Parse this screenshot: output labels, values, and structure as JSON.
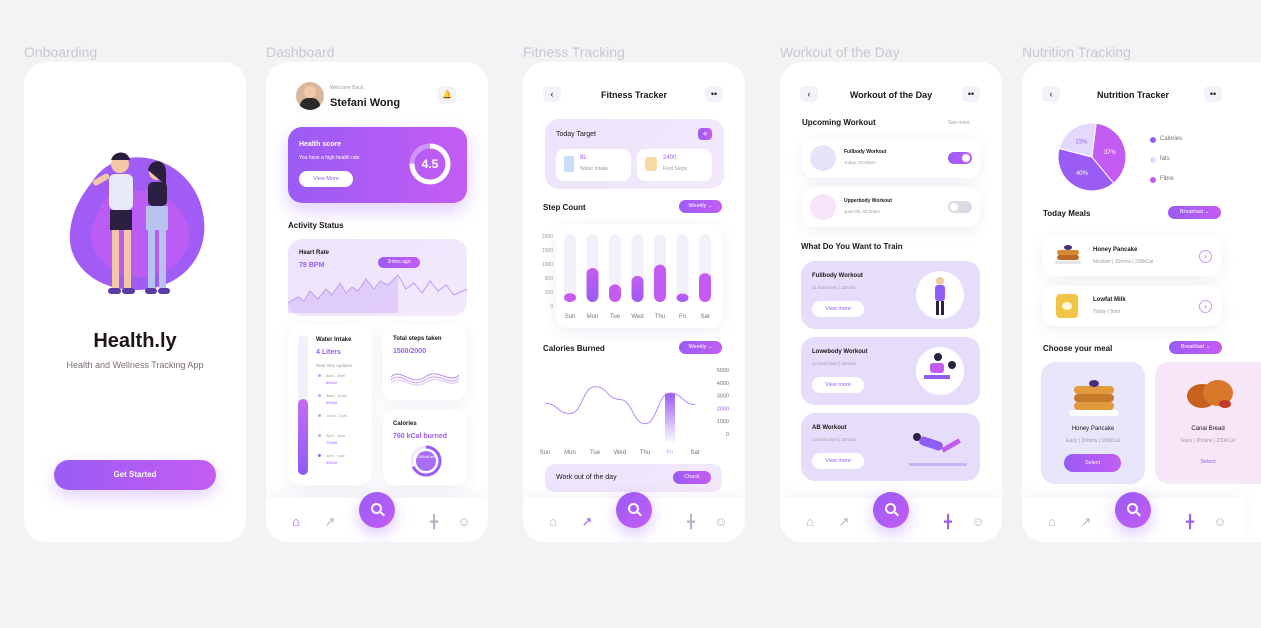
{
  "screen_titles": [
    "Onboarding",
    "Dashboard",
    "Fitness Tracking",
    "Workout of the Day",
    "Nutrition Tracking"
  ],
  "onboarding": {
    "app_name": "Health.ly",
    "tagline": "Health and Wellness  Tracking App",
    "cta": "Get Started"
  },
  "dashboard": {
    "welcome": "Welcome Back,",
    "user_name": "Stefani Wong",
    "health_title": "Health score",
    "health_sub": "You have a high health rate",
    "health_btn": "View More",
    "health_score": "4.5",
    "activity_title": "Activity Status",
    "heart_title": "Heart Rate",
    "heart_value": "78 BPM",
    "heart_badge": "3mins ago",
    "water_title": "Water Intake",
    "water_value": "4 Liters",
    "water_sub": "Real time updates",
    "water_log": [
      {
        "time": "6am - 8am",
        "amount": "600ml"
      },
      {
        "time": "9am - 11am",
        "amount": "500ml"
      },
      {
        "time": "11am - 2pm",
        "amount": ""
      },
      {
        "time": "2pm - 4pm",
        "amount": "700ml"
      },
      {
        "time": "4pm - now",
        "amount": "900ml"
      }
    ],
    "steps_title": "Total steps taken",
    "steps_value": "1500/2000",
    "cal_title": "Calories",
    "cal_value": "760 kCal burned",
    "cal_ring": "230kcal left"
  },
  "fitness": {
    "title": "Fitness Tracker",
    "target_title": "Today Target",
    "water_value": "8L",
    "water_label": "Water Intake",
    "steps_value": "2400",
    "steps_label": "Foot Steps",
    "steps_chart_title": "Step Count",
    "steps_period": "Weekly",
    "cal_chart_title": "Calories Burned",
    "cal_period": "Weekly",
    "workout_text": "Work out of the day",
    "workout_btn": "Check",
    "left_ticks": [
      "2000",
      "1500",
      "1000",
      "500",
      "100",
      "0"
    ],
    "right_ticks": [
      "5000",
      "4000",
      "3000",
      "2000",
      "1000",
      "0"
    ]
  },
  "chart_data": [
    {
      "type": "bar",
      "title": "Step Count",
      "categories": [
        "Sun",
        "Mon",
        "Tue",
        "Wed",
        "Thu",
        "Fri",
        "Sat"
      ],
      "values": [
        260,
        1000,
        520,
        770,
        1100,
        250,
        850
      ],
      "ylim": [
        0,
        2000
      ]
    },
    {
      "type": "line",
      "title": "Calories Burned",
      "categories": [
        "Sun",
        "Mon",
        "Tue",
        "Wed",
        "Thu",
        "Fri",
        "Sat"
      ],
      "values": [
        2400,
        1600,
        3700,
        2700,
        800,
        3200,
        2300
      ],
      "ylim": [
        0,
        5000
      ]
    }
  ],
  "workout": {
    "title": "Workout of the Day",
    "upcoming_title": "Upcoming Workout",
    "see_more": "See more",
    "upcoming": [
      {
        "name": "Fullbody Workout",
        "when": "Today, 03:00pm",
        "on": true
      },
      {
        "name": "Upperbody Workout",
        "when": "June 05, 02:00pm",
        "on": false
      }
    ],
    "train_title": "What Do You Want to Train",
    "trains": [
      {
        "name": "Fullbody Workout",
        "detail": "11 Exercises | 32mins",
        "btn": "View more"
      },
      {
        "name": "Lowebody Workout",
        "detail": "12 Exercises | 40mins",
        "btn": "View more"
      },
      {
        "name": "AB Workout",
        "detail": "14 Exercises | 20mins",
        "btn": "View more"
      }
    ]
  },
  "nutrition": {
    "title": "Nutrition Tracker",
    "pie": {
      "labels": [
        "Calories",
        "fats",
        "Fibre"
      ],
      "values": [
        40,
        23,
        37
      ],
      "texts": [
        "40%",
        "23%",
        "37%"
      ]
    },
    "meals_title": "Today Meals",
    "meals_period": "Breakfast",
    "meals": [
      {
        "name": "Honey Pancake",
        "detail": "Medium | 30mins | 230kCal"
      },
      {
        "name": "Lowfat Milk",
        "detail": "Today | 8am"
      }
    ],
    "choose_title": "Choose your meal",
    "choose_period": "Breakfast",
    "choices": [
      {
        "name": "Honey Pancake",
        "detail": "Easy | 30mins | 180kCal",
        "btn": "Select"
      },
      {
        "name": "Canai Bread",
        "detail": "Easy | 20mins | 230kCal",
        "btn": "Select"
      }
    ]
  },
  "colors": {
    "accent": "#9b5cf6",
    "accent2": "#c45cf3",
    "bg": "#f3f3f5"
  }
}
